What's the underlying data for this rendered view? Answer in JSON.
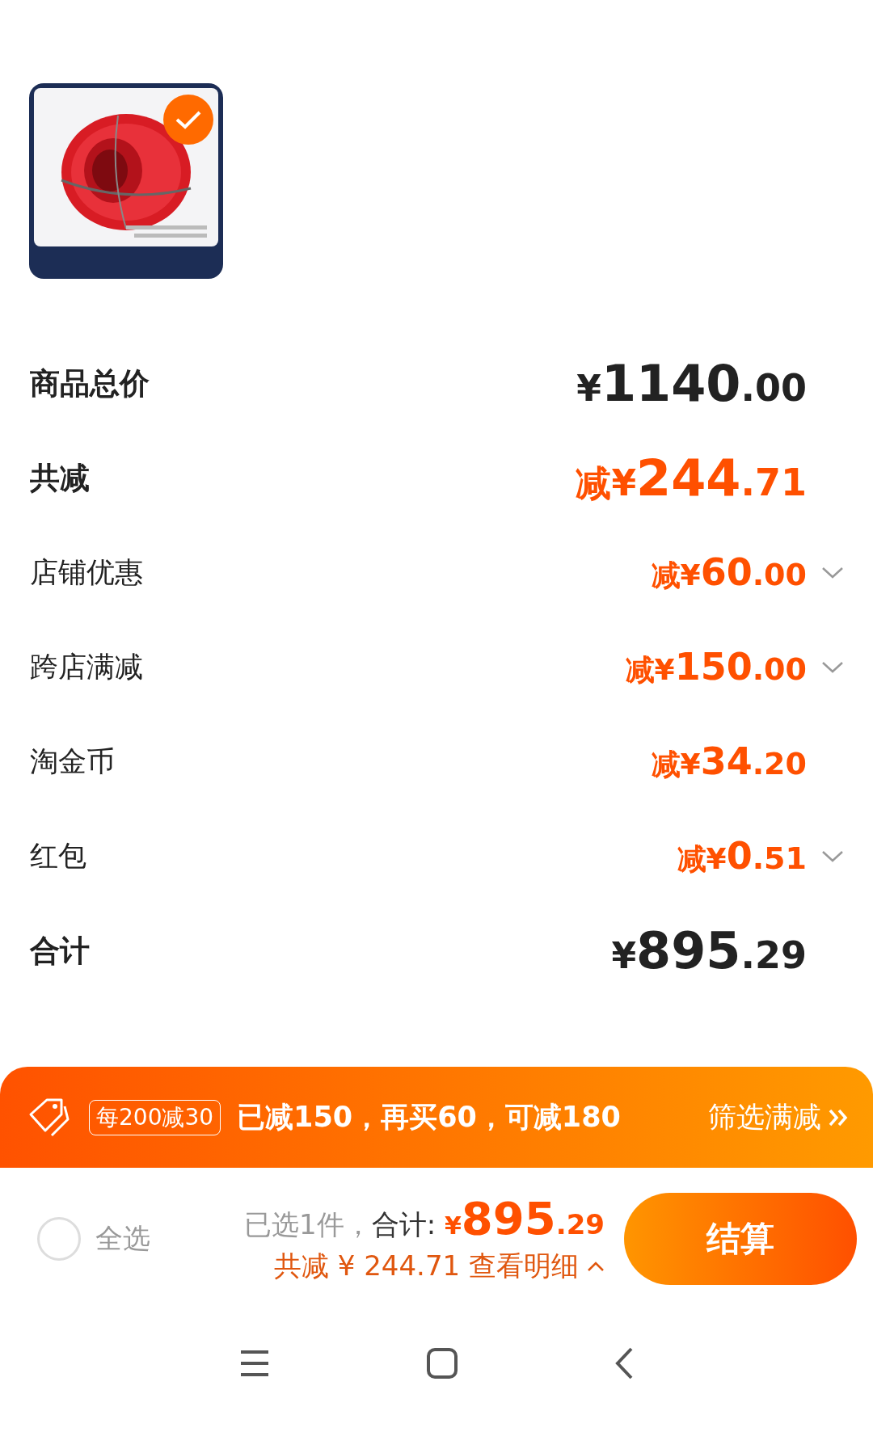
{
  "product": {
    "kind": "picture",
    "selected": true
  },
  "rows": [
    {
      "label": "商品总价",
      "kind": "total",
      "prefix": "¥",
      "integer": "1140",
      "decimal": ".00"
    },
    {
      "label": "共减",
      "kind": "discount-total",
      "prefix": "减¥",
      "integer": "244",
      "decimal": ".71"
    },
    {
      "label": "店铺优惠",
      "kind": "discount",
      "prefix": "减¥",
      "integer": "60",
      "decimal": ".00",
      "expanded": false
    },
    {
      "label": "跨店满减",
      "kind": "discount",
      "prefix": "减¥",
      "integer": "150",
      "decimal": ".00",
      "expanded": false
    },
    {
      "label": "淘金币",
      "kind": "discount",
      "prefix": "减¥",
      "integer": "34",
      "decimal": ".20"
    },
    {
      "label": "红包",
      "kind": "discount",
      "prefix": "减¥",
      "integer": "0",
      "decimal": ".51",
      "expanded": false
    },
    {
      "label": "合计",
      "kind": "total",
      "prefix": "¥",
      "integer": "895",
      "decimal": ".29"
    }
  ],
  "promo_banner": {
    "badge": "每200减30",
    "message": "已减150，再买60，可减180",
    "link": "筛选满减"
  },
  "checkout_bar": {
    "select_all": {
      "label": "全选",
      "checked": false
    },
    "selected_count": "已选1件，",
    "total_label": "合计:",
    "currency": "¥",
    "total_integer": "895",
    "total_decimal": ".29",
    "savings": "共减 ¥ 244.71 查看明细",
    "details_expanded": false,
    "button": "结算"
  }
}
